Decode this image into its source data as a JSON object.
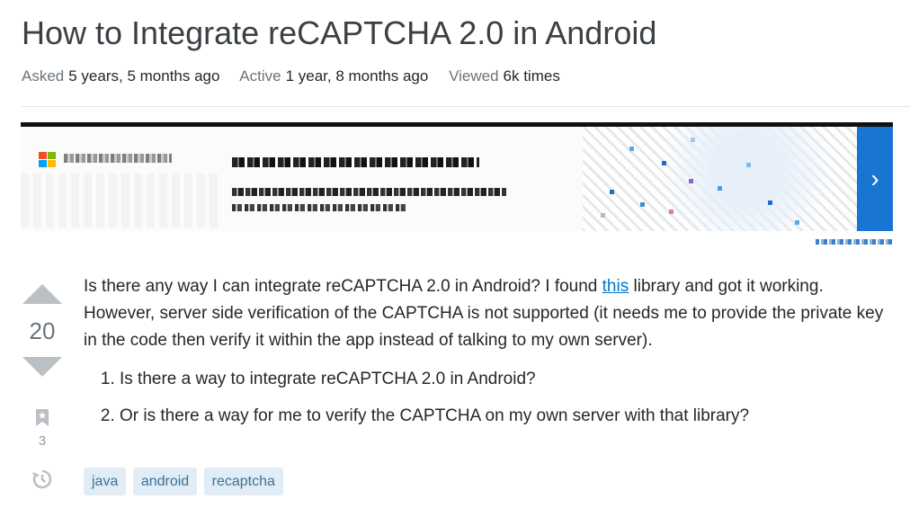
{
  "question": {
    "title": "How to Integrate reCAPTCHA 2.0 in Android",
    "meta": [
      {
        "label": "Asked",
        "value": "5 years, 5 months ago"
      },
      {
        "label": "Active",
        "value": "1 year, 8 months ago"
      },
      {
        "label": "Viewed",
        "value": "6k times"
      }
    ],
    "score": "20",
    "bookmark_count": "3",
    "body": {
      "p1_before": "Is there any way I can integrate reCAPTCHA 2.0 in Android? I found ",
      "p1_link": "this",
      "p1_after": " library and got it working. However, server side verification of the CAPTCHA is not supported (it needs me to provide the private key in the code then verify it within the app instead of talking to my own server).",
      "list": [
        "Is there a way to integrate reCAPTCHA 2.0 in Android?",
        "Or is there a way for me to verify the CAPTCHA on my own server with that library?"
      ]
    },
    "tags": [
      "java",
      "android",
      "recaptcha"
    ]
  },
  "icons": {
    "upvote": "triangle-up-icon",
    "downvote": "triangle-down-icon",
    "bookmark": "bookmark-icon",
    "history": "history-icon",
    "ad_cta": "chevron-right-icon"
  },
  "ad": {
    "cta_glyph": "›"
  },
  "colors": {
    "accent_link": "#0077cc",
    "tag_bg": "#e1ecf4",
    "tag_text": "#39739d",
    "vote_arrow": "#bbc0c4",
    "ad_cta_bg": "#1875d1"
  }
}
